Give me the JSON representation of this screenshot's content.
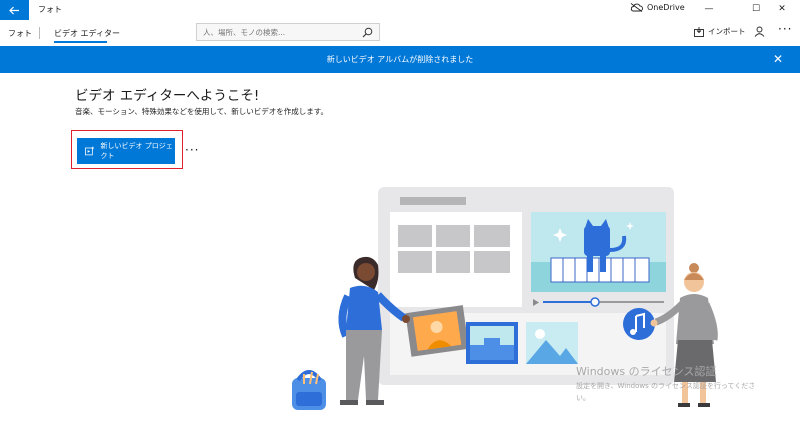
{
  "window": {
    "app_title": "フォト",
    "onedrive_label": "OneDrive",
    "minimize": "—",
    "maximize": "☐",
    "close": "✕"
  },
  "nav": {
    "photos_label": "フォト",
    "video_editor_label": "ビデオ エディター",
    "search_placeholder": "人、場所、モノの検索...",
    "import_label": "インポート",
    "more": "···"
  },
  "banner": {
    "text": "新しいビデオ アルバムが削除されました",
    "close": "✕"
  },
  "main": {
    "title": "ビデオ エディターへようこそ!",
    "subtitle": "音楽、モーション、特殊効果などを使用して、新しいビデオを作成します。",
    "new_project_label": "新しいビデオ プロジェクト",
    "more": "···"
  },
  "watermark": {
    "title": "Windows のライセンス認証",
    "line1": "設定を開き、Windows のライセンス認証を行ってくださ",
    "line2": "い。"
  },
  "colors": {
    "accent": "#0078d7",
    "highlight": "#e0202c"
  }
}
